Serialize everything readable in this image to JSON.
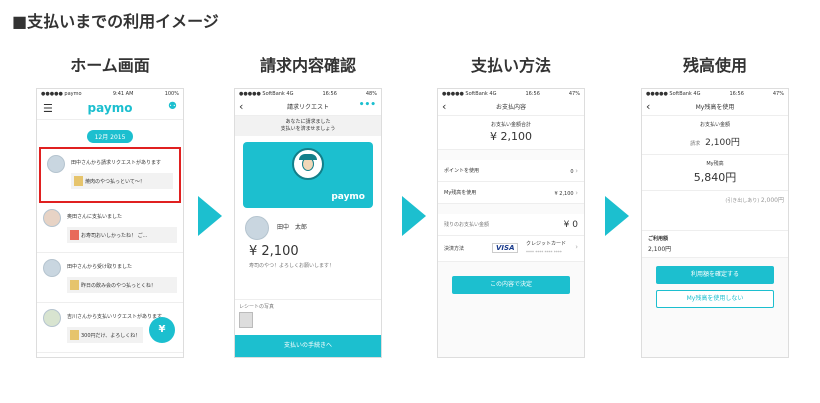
{
  "page_title": "■支払いまでの利用イメージ",
  "steps": [
    {
      "label": "ホーム画面"
    },
    {
      "label": "請求内容確認"
    },
    {
      "label": "支払い方法"
    },
    {
      "label": "残高使用"
    }
  ],
  "phone1": {
    "carrier": "●●●●● paymo",
    "time": "9:41 AM",
    "battery": "100%",
    "logo": "paymo",
    "date_badge": "12月 2015",
    "feed": [
      {
        "text": "田中さんから請求リクエストがあります",
        "sub": "",
        "message": "焼肉のやつ払っといて〜！"
      },
      {
        "text": "奥田さんに支払いました",
        "sub": "",
        "message": "お寿司おいしかったね！ ご..."
      },
      {
        "text": "田中さんから受け取りました",
        "sub": "",
        "message": "昨日の飲み会のやつ払っとくね！"
      },
      {
        "text": "吉川さんから支払いリクエストがあります",
        "sub": "",
        "message": "300円だけ、よろしくね！"
      }
    ],
    "fab_label": "¥"
  },
  "phone2": {
    "carrier": "●●●●● SoftBank 4G",
    "time": "16:56",
    "battery": "48%",
    "nav_title": "請求リクエスト",
    "intro": "あなたに請求ました\n支払いを済ませましょう",
    "card_logo": "paymo",
    "name": "田中　太郎",
    "amount": "¥ 2,100",
    "message": "寿司のやつ！よろしくお願いします！",
    "receipt_label": "レシートの写真",
    "cta": "支払いの手続きへ"
  },
  "phone3": {
    "carrier": "●●●●● SoftBank 4G",
    "time": "16:56",
    "battery": "47%",
    "nav_title": "お支払内容",
    "total_label": "お支払い金額合計",
    "total": "¥ 2,100",
    "rows": [
      {
        "label": "ポイントを使用",
        "value": "0"
      },
      {
        "label": "My残高を使用",
        "value": "¥ 2,100"
      }
    ],
    "remain_label": "残りのお支払い金額",
    "remain": "¥ 0",
    "method_label": "決済方法",
    "card_brand": "VISA",
    "card_name": "クレジットカード",
    "card_no": "**** **** **** ****",
    "cta": "この内容で決定"
  },
  "phone4": {
    "carrier": "●●●●● SoftBank 4G",
    "time": "16:56",
    "battery": "47%",
    "nav_title": "My残高を使用",
    "pay_label": "お支払い金額",
    "pay_prefix": "請求",
    "pay_amount": "2,100円",
    "balance_label": "My残高",
    "balance": "5,840円",
    "remaining_prefix": "(引き出しあり)",
    "remaining": "2,000円",
    "use_label": "ご利用額",
    "use_value": "2,100円",
    "confirm": "利用額を確定する",
    "cancel": "My残高を使用しない"
  }
}
